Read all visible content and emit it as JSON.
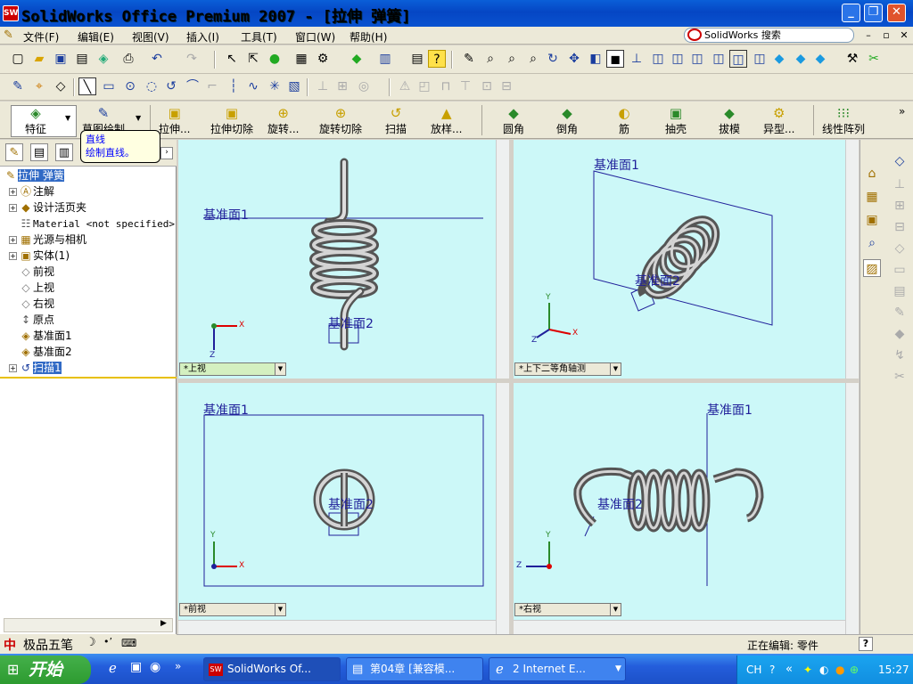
{
  "window": {
    "app_icon": "SW",
    "title": "SolidWorks Office Premium 2007 - [拉伸 弹簧]"
  },
  "menu": {
    "items": [
      "文件(F)",
      "编辑(E)",
      "视图(V)",
      "插入(I)",
      "工具(T)",
      "窗口(W)",
      "帮助(H)"
    ]
  },
  "search": {
    "placeholder": "SolidWorks 搜索"
  },
  "command_manager": {
    "items": [
      "特征",
      "草图绘制",
      "拉伸...",
      "拉伸切除",
      "旋转...",
      "旋转切除",
      "扫描",
      "放样...",
      "圆角",
      "倒角",
      "筋",
      "抽壳",
      "拔模",
      "异型...",
      "线性阵列"
    ]
  },
  "tooltip": {
    "title": "直线",
    "description": "绘制直线。"
  },
  "feature_tree": {
    "root": "拉伸 弹簧",
    "items": [
      "注解",
      "设计活页夹",
      "Material <not specified>",
      "光源与相机",
      "实体(1)",
      "前视",
      "上视",
      "右视",
      "原点",
      "基准面1",
      "基准面2",
      "扫描1"
    ]
  },
  "viewports": {
    "top_left": {
      "view": "*上视",
      "plane1": "基准面1",
      "plane2": "基准面2"
    },
    "top_right": {
      "view": "*上下二等角轴测",
      "plane1": "基准面1",
      "plane2": "基准面2"
    },
    "bottom_left": {
      "view": "*前视",
      "plane1": "基准面1",
      "plane2": "基准面2"
    },
    "bottom_right": {
      "view": "*右视",
      "plane1": "基准面1",
      "plane2": "基准面2"
    }
  },
  "axes": {
    "x": "X",
    "y": "Y",
    "z": "Z"
  },
  "ime": {
    "label": "极品五笔"
  },
  "status": {
    "editing": "正在编辑: 零件",
    "help": "?"
  },
  "taskbar": {
    "start": "开始",
    "tasks": [
      "SolidWorks Of...",
      "第04章 [兼容模...",
      "2 Internet E..."
    ],
    "lang": "CH",
    "clock": "15:27"
  },
  "colors": {
    "viewport_bg": "#ccf8f8",
    "titlebar": "#0a5fd8",
    "plane_line": "#20209a"
  }
}
